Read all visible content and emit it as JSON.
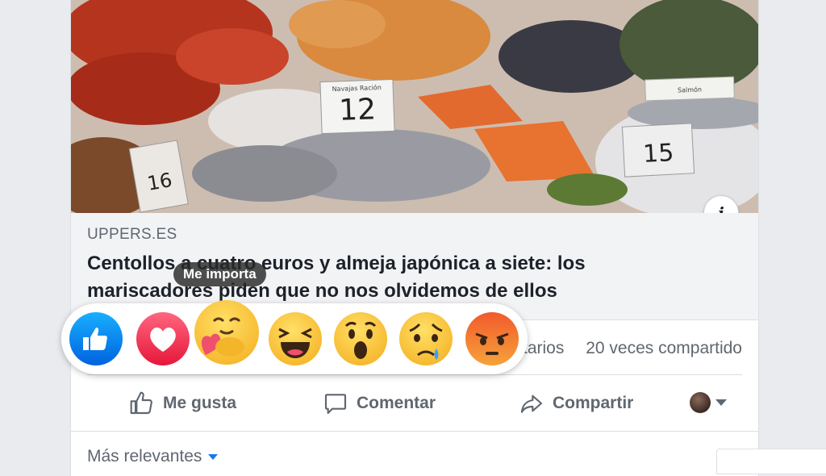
{
  "post": {
    "domain": "UPPERS.ES",
    "headline": "Centollos a cuatro euros y almeja japónica a siete: los mariscadores piden que no nos olvidemos de ellos",
    "photo_price_tags": [
      "12",
      "15",
      "16"
    ],
    "photo_tag_labels": [
      "Navajas Ración",
      "Salmón"
    ]
  },
  "stats": {
    "comments_partial": "tarios",
    "shares": "20 veces compartido"
  },
  "actions": {
    "like": "Me gusta",
    "comment": "Comentar",
    "share": "Compartir"
  },
  "comments": {
    "sort_label": "Más relevantes"
  },
  "reactions": {
    "tooltip": "Me importa",
    "items": [
      "like",
      "love",
      "care",
      "haha",
      "wow",
      "sad",
      "angry"
    ]
  },
  "colors": {
    "page_bg": "#e9ebee",
    "link_box_bg": "#f2f3f5",
    "text_secondary": "#606770",
    "accent_blue": "#1877f2"
  },
  "icons": {
    "info": "info-icon",
    "like": "thumbs-up-icon",
    "comment": "speech-bubble-icon",
    "share": "share-arrow-icon"
  }
}
